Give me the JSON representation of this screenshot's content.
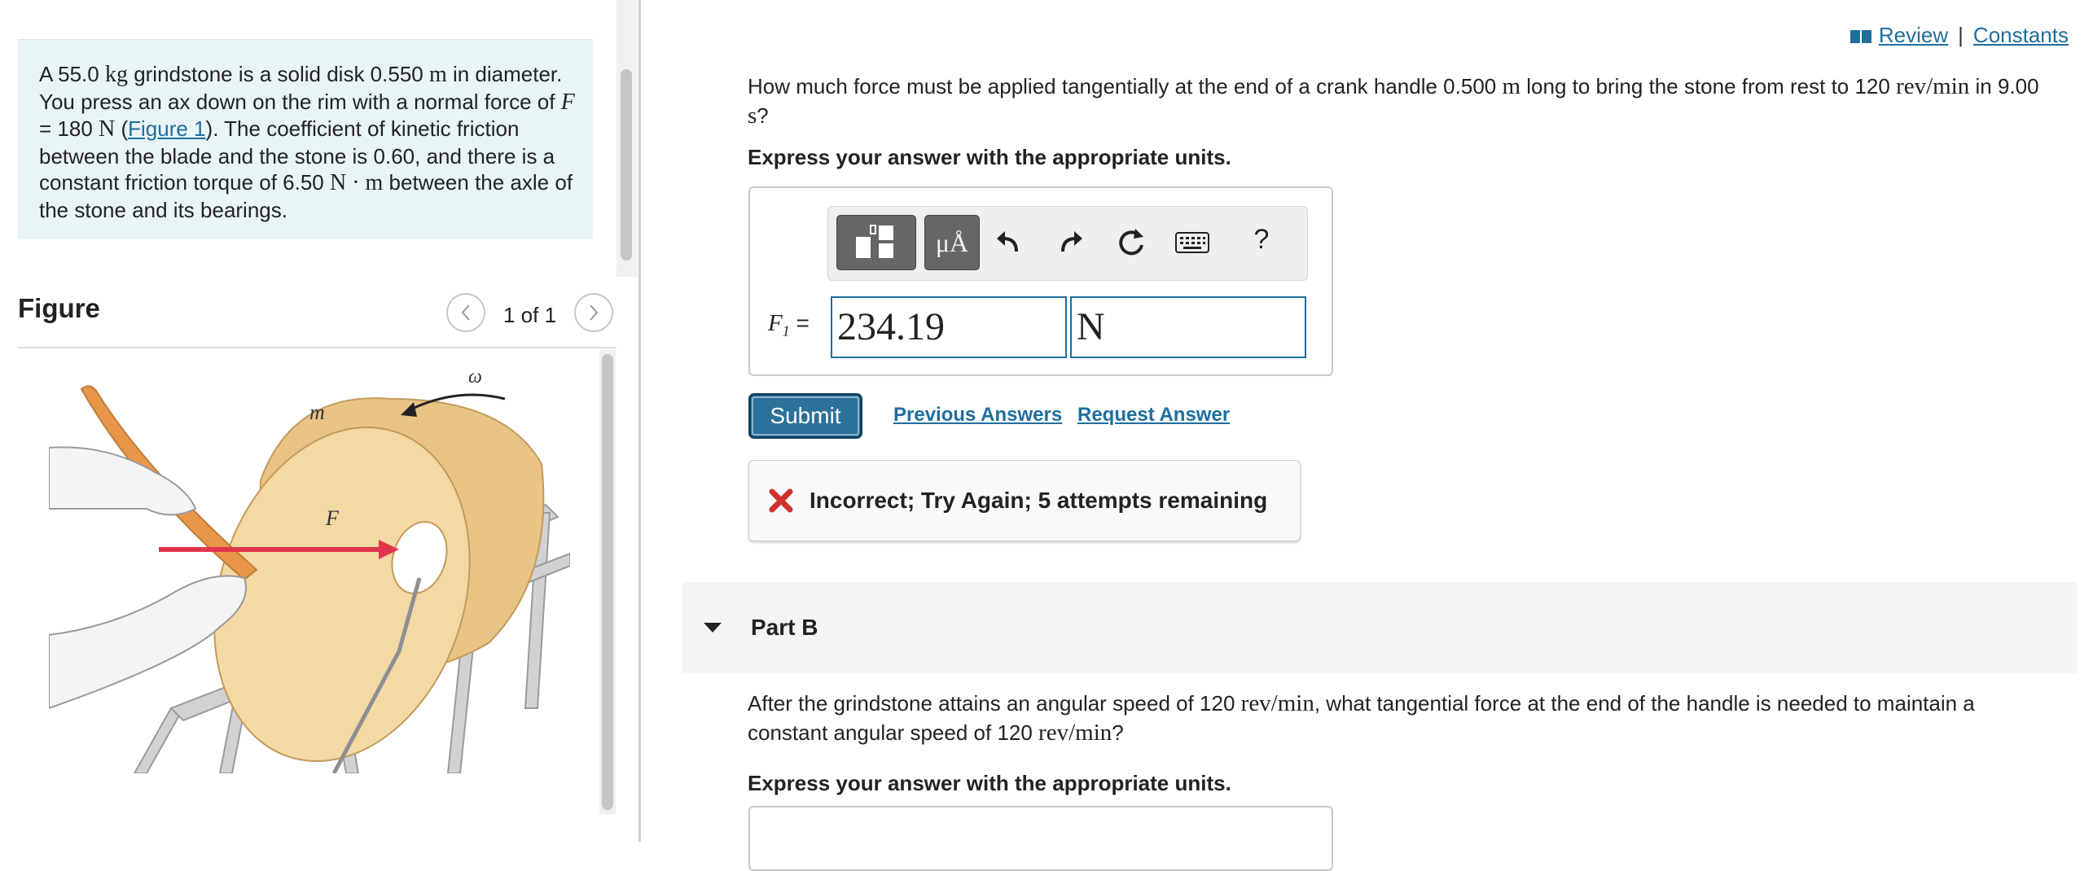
{
  "problem": {
    "segments": [
      {
        "t": "A 55.0 "
      },
      {
        "m": "kg"
      },
      {
        "t": " grindstone is a solid disk 0.550 "
      },
      {
        "m": "m"
      },
      {
        "t": " in diameter. You press an ax down on the rim with a normal force of "
      },
      {
        "m": "F",
        "italic": true
      },
      {
        "t": " = 180 "
      },
      {
        "m": "N"
      },
      {
        "t": " ("
      },
      {
        "link": "Figure 1"
      },
      {
        "t": "). The coefficient of kinetic friction between the blade and the stone is 0.60, and there is a constant friction torque of 6.50 "
      },
      {
        "m": "N · m"
      },
      {
        "t": " between the axle of the stone and its bearings."
      }
    ]
  },
  "figure": {
    "title": "Figure",
    "counter": "1 of 1",
    "labels": {
      "mass": "m",
      "omega": "ω",
      "force": "F"
    },
    "colors": {
      "disk_face": "#f3d9a4",
      "disk_rim": "#e8c486",
      "arrow": "#e0364d",
      "handle": "#e8974a",
      "stand": "#cfcfd2"
    }
  },
  "header": {
    "review": "Review",
    "separator": "|",
    "constants": "Constants"
  },
  "part_a": {
    "question": [
      {
        "t": "How much force must be applied tangentially at the end of a crank handle 0.500 "
      },
      {
        "m": "m"
      },
      {
        "t": " long to bring the stone from rest to 120 "
      },
      {
        "m": "rev/min"
      },
      {
        "t": " in 9.00 "
      },
      {
        "m": "s"
      },
      {
        "t": "?"
      }
    ],
    "instruction": "Express your answer with the appropriate units.",
    "toolbar": {
      "units_label": "μÅ",
      "help_label": "?",
      "icons": [
        "templates-icon",
        "units-icon",
        "undo-icon",
        "redo-icon",
        "reset-icon",
        "keyboard-icon",
        "help-icon"
      ]
    },
    "variable": "F",
    "variable_sub": "1",
    "equals": "=",
    "value": "234.19",
    "units": "N",
    "submit_label": "Submit",
    "previous_answers": "Previous Answers",
    "request_answer": "Request Answer",
    "feedback": "Incorrect; Try Again; 5 attempts remaining",
    "feedback_color": "#d0312d"
  },
  "part_b": {
    "title": "Part B",
    "question": [
      {
        "t": "After the grindstone attains an angular speed of 120 "
      },
      {
        "m": "rev/min"
      },
      {
        "t": ", what tangential force at the end of the handle is needed to maintain a constant angular speed of 120 "
      },
      {
        "m": "rev/min"
      },
      {
        "t": "?"
      }
    ],
    "instruction": "Express your answer with the appropriate units."
  },
  "colors": {
    "link": "#1e6e9e",
    "accent": "#2b7199",
    "problem_bg": "#e8f4f6"
  }
}
